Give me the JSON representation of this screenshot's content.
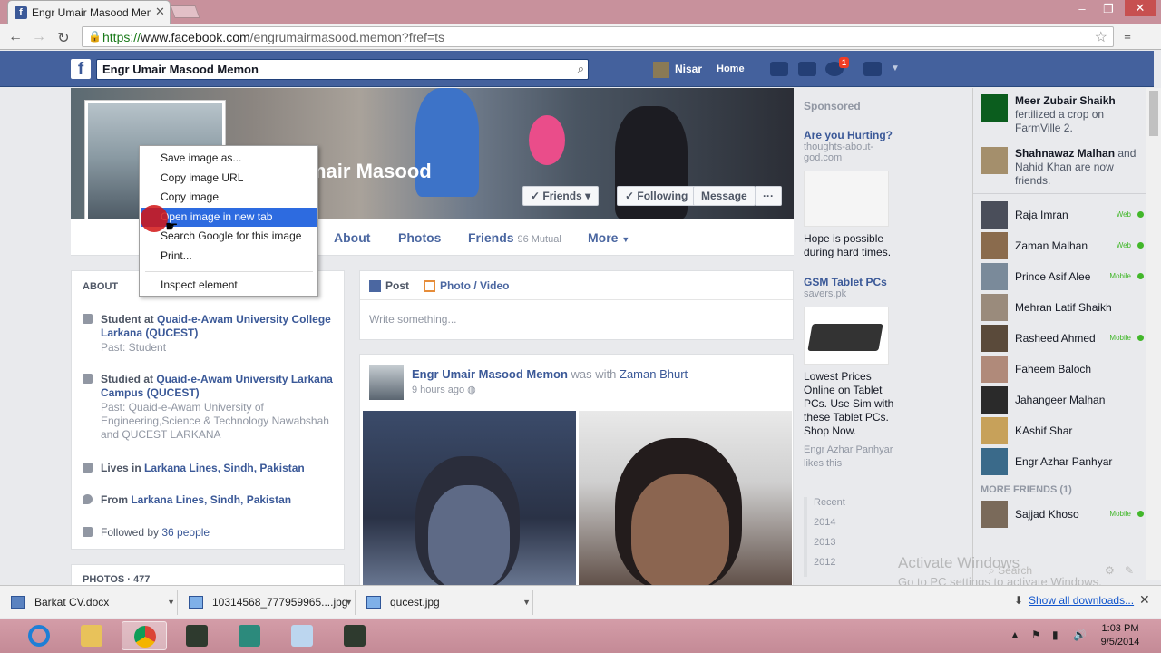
{
  "browser": {
    "tab_title": "Engr Umair Masood Mem",
    "url_scheme": "https://",
    "url_host": "www.facebook.com",
    "url_path": "/engrumairmasood.memon?fref=ts"
  },
  "fb_header": {
    "logo": "f",
    "search_value": "Engr Umair Masood Memon",
    "user_name": "Nisar",
    "home_label": "Home",
    "notification_count": "1"
  },
  "profile": {
    "cover_name": "mair Masood",
    "friends_btn": "Friends",
    "following_btn": "Following",
    "message_btn": "Message",
    "more_dots": "···",
    "tabs": [
      {
        "label": "About"
      },
      {
        "label": "Photos"
      },
      {
        "label": "Friends",
        "count": "96 Mutual"
      },
      {
        "label": "More"
      }
    ]
  },
  "context_menu": {
    "items": [
      "Save image as...",
      "Copy image URL",
      "Copy image",
      "Open image in new tab",
      "Search Google for this image",
      "Print...",
      "Inspect element"
    ]
  },
  "about": {
    "heading": "ABOUT",
    "items": [
      {
        "text": "Student at ",
        "link": "Quaid-e-Awam University College Larkana (QUCEST)",
        "sub": "Past: Student"
      },
      {
        "text": "Studied at ",
        "link": "Quaid-e-Awam University Larkana Campus (QUCEST)",
        "sub": "Past: Quaid-e-Awam University of Engineering,Science & Technology Nawabshah and QUCEST LARKANA"
      },
      {
        "text": "Lives in ",
        "link": "Larkana Lines, Sindh, Pakistan"
      },
      {
        "text": "From ",
        "link": "Larkana Lines, Sindh, Pakistan"
      },
      {
        "text": "Followed by ",
        "link": "36 people"
      }
    ],
    "photos_heading": "PHOTOS · 477"
  },
  "composer": {
    "post_label": "Post",
    "photo_label": "Photo / Video",
    "placeholder": "Write something..."
  },
  "post": {
    "author": "Engr Umair Masood Memon",
    "with_text": " was with ",
    "with_name": "Zaman Bhurt",
    "time": "9 hours ago"
  },
  "sponsored": {
    "heading": "Sponsored",
    "ads": [
      {
        "title": "Are you Hurting?",
        "source": "thoughts-about-god.com",
        "body": "Hope is possible during hard times."
      },
      {
        "title": "GSM Tablet PCs",
        "source": "savers.pk",
        "body": "Lowest Prices Online on Tablet PCs. Use Sim with these Tablet PCs. Shop Now.",
        "likes": "Engr Azhar Panhyar likes this"
      }
    ],
    "timeline": [
      "Recent",
      "2014",
      "2013",
      "2012"
    ]
  },
  "chat": {
    "ticker": [
      {
        "name": "Meer Zubair Shaikh",
        "rest": " fertilized a crop on FarmVille 2."
      },
      {
        "name": "Shahnawaz Malhan",
        "rest": " and Nahid Khan are now friends."
      }
    ],
    "buddies": [
      {
        "name": "Raja Imran",
        "status": "Web"
      },
      {
        "name": "Zaman Malhan",
        "status": "Web"
      },
      {
        "name": "Prince Asif Alee",
        "status": "Mobile"
      },
      {
        "name": "Mehran Latif Shaikh",
        "status": ""
      },
      {
        "name": "Rasheed Ahmed",
        "status": "Mobile"
      },
      {
        "name": "Faheem Baloch",
        "status": ""
      },
      {
        "name": "Jahangeer Malhan",
        "status": ""
      },
      {
        "name": "KAshif Shar",
        "status": ""
      },
      {
        "name": "Engr Azhar Panhyar",
        "status": ""
      }
    ],
    "more_friends": "MORE FRIENDS (1)",
    "more": [
      {
        "name": "Sajjad Khoso",
        "status": "Mobile"
      }
    ],
    "search_placeholder": "Search"
  },
  "watermark": {
    "line1": "Activate Windows",
    "line2": "Go to PC settings to activate Windows."
  },
  "downloads": {
    "files": [
      "Barkat CV.docx",
      "10314568_777959965....jpg",
      "qucest.jpg"
    ],
    "show_all": "Show all downloads..."
  },
  "taskbar": {
    "time": "1:03 PM",
    "date": "9/5/2014"
  }
}
